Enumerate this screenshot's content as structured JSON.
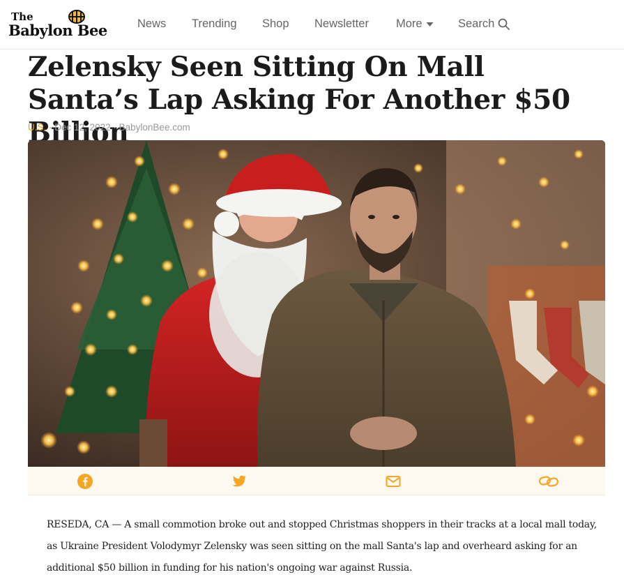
{
  "site": {
    "logo_the": "The",
    "logo_name": "Babylon Bee"
  },
  "nav": {
    "items": [
      {
        "label": "News"
      },
      {
        "label": "Trending"
      },
      {
        "label": "Shop"
      },
      {
        "label": "Newsletter"
      },
      {
        "label": "More"
      },
      {
        "label": "Search"
      }
    ]
  },
  "article": {
    "headline": "Zelensky Seen Sitting On Mall Santa’s Lap Asking For Another $50 Billion",
    "category": "U.S.",
    "date": "Dec 12, 2022",
    "source": "BabylonBee.com",
    "separator": "·",
    "body": "RESEDA, CA — A small commotion broke out and stopped Christmas shoppers in their tracks at a local mall today, as Ukraine President Volodymyr Zelensky was seen sitting on the mall Santa's lap and overheard asking for an additional $50 billion in funding for his nation's ongoing war against Russia."
  },
  "share": {
    "buttons": [
      "facebook-icon",
      "twitter-icon",
      "email-icon",
      "link-icon"
    ],
    "color": "#f5a623"
  },
  "colors": {
    "accent": "#f0a500",
    "nav_text": "#666666",
    "headline": "#1b1b1b"
  }
}
